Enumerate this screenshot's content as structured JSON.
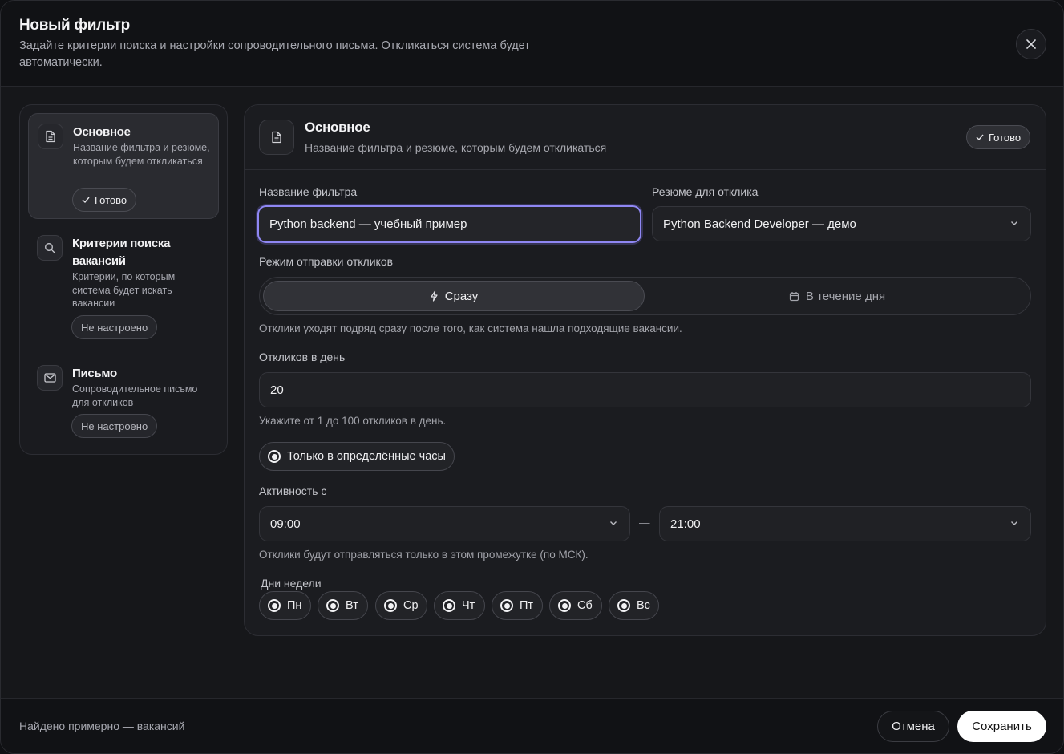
{
  "header": {
    "title": "Новый фильтр",
    "subtitle": "Задайте критерии поиска и настройки сопроводительного письма. Откликаться система будет автоматически.",
    "close_icon": "close-icon"
  },
  "sidebar": {
    "items": [
      {
        "title": "Основное",
        "description": "Название фильтра и резюме, которым будем откликаться",
        "status": "Готово",
        "icon": "document-icon",
        "active": true
      },
      {
        "title": "Критерии поиска вакансий",
        "description": "Критерии, по которым система будет искать вакансии",
        "status": "Не настроено",
        "icon": "search-icon",
        "active": false
      },
      {
        "title": "Письмо",
        "description": "Сопроводительное письмо для откликов",
        "status": "Не настроено",
        "icon": "mail-icon",
        "active": false
      }
    ]
  },
  "panel": {
    "title": "Основное",
    "subtitle": "Название фильтра и резюме, которым будем откликаться",
    "status": "Готово",
    "filter_name_label": "Название фильтра",
    "filter_name_value": "Python backend — учебный пример",
    "resume_label": "Резюме для отклика",
    "resume_value": "Python Backend Developer — демо",
    "mode_label": "Режим отправки откликов",
    "mode_options": [
      {
        "label": "Сразу",
        "icon": "lightning-icon",
        "selected": true
      },
      {
        "label": "В течение дня",
        "icon": "calendar-icon",
        "selected": false
      }
    ],
    "mode_hint": "Отклики уходят подряд сразу после того, как система нашла подходящие вакансии.",
    "per_day_label": "Откликов в день",
    "per_day_value": "20",
    "per_day_hint": "Укажите от 1 до 100 откликов в день.",
    "hours_toggle_label": "Только в определённые часы",
    "activity_label": "Активность с",
    "time_from": "09:00",
    "time_dash": "—",
    "time_to": "21:00",
    "activity_hint": "Отклики будут отправляться только в этом промежутке (по МСК).",
    "days_label": "Дни недели",
    "days": [
      "Пн",
      "Вт",
      "Ср",
      "Чт",
      "Пт",
      "Сб",
      "Вс"
    ]
  },
  "footer": {
    "found_text": "Найдено примерно — вакансий",
    "cancel_label": "Отмена",
    "save_label": "Сохранить"
  },
  "colors": {
    "background": "#141518",
    "focus_ring": "#8f87f3",
    "save_button": "#ffffff"
  }
}
